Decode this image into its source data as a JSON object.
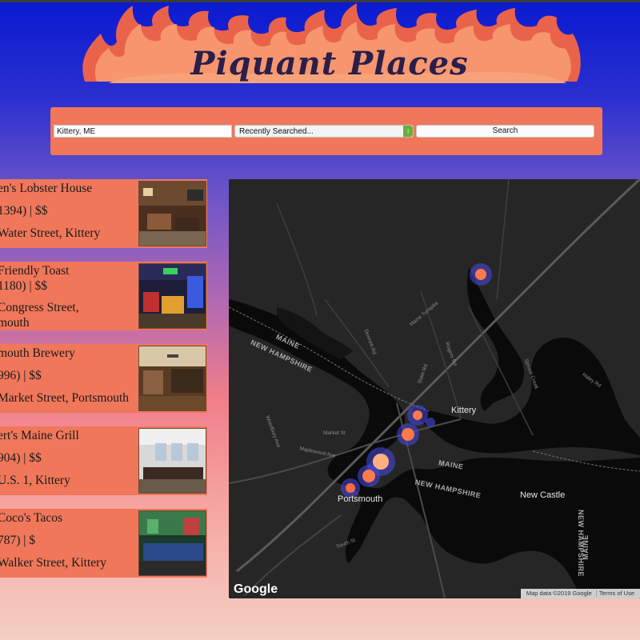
{
  "header": {
    "title": "Piquant Places"
  },
  "search": {
    "location_value": "Kittery, ME",
    "recent_selected": "Recently Searched...",
    "search_label": "Search"
  },
  "results": [
    {
      "name": "en's Lobster House",
      "meta": "1394) | $$",
      "address": "Water Street, Kittery",
      "address2": ""
    },
    {
      "name": "Friendly Toast",
      "meta": "1180) | $$",
      "address": "Congress Street,",
      "address2": "mouth"
    },
    {
      "name": "mouth Brewery",
      "meta": "996) | $$",
      "address": "Market Street, Portsmouth",
      "address2": ""
    },
    {
      "name": "ert's Maine Grill",
      "meta": "904) | $$",
      "address": "U.S. 1, Kittery",
      "address2": ""
    },
    {
      "name": "Coco's Tacos",
      "meta": "787) | $",
      "address": "Walker Street, Kittery",
      "address2": ""
    }
  ],
  "map": {
    "labels": {
      "kittery": "Kittery",
      "portsmouth": "Portsmouth",
      "new_castle": "New Castle",
      "maine_1": "MAINE",
      "nh_1": "NEW HAMPSHIRE",
      "maine_2": "MAINE",
      "nh_2": "NEW HAMPSHIRE",
      "maine_3": "MAINE",
      "nh_3": "NEW HAMPSHIRE",
      "maine_turnpike": "Maine Turnpike",
      "state_rd": "State Rd",
      "dennett_rd": "Dennett Rd",
      "rogers_rd": "Rogers Rd",
      "market_st": "Market St",
      "maplewood_ave": "Maplewood Ave",
      "woodbury_ave": "Woodbury Ave",
      "south_st": "South St",
      "spruce_creek": "Spruce Creek",
      "haley_rd": "Haley Rd"
    },
    "google": "Google",
    "attribution": [
      "Map data ©2019 Google",
      "Terms of Use"
    ]
  },
  "colors": {
    "panel": "#f0775a",
    "heat_core": "#ff7a4a",
    "heat_halo": "#4848e8"
  }
}
